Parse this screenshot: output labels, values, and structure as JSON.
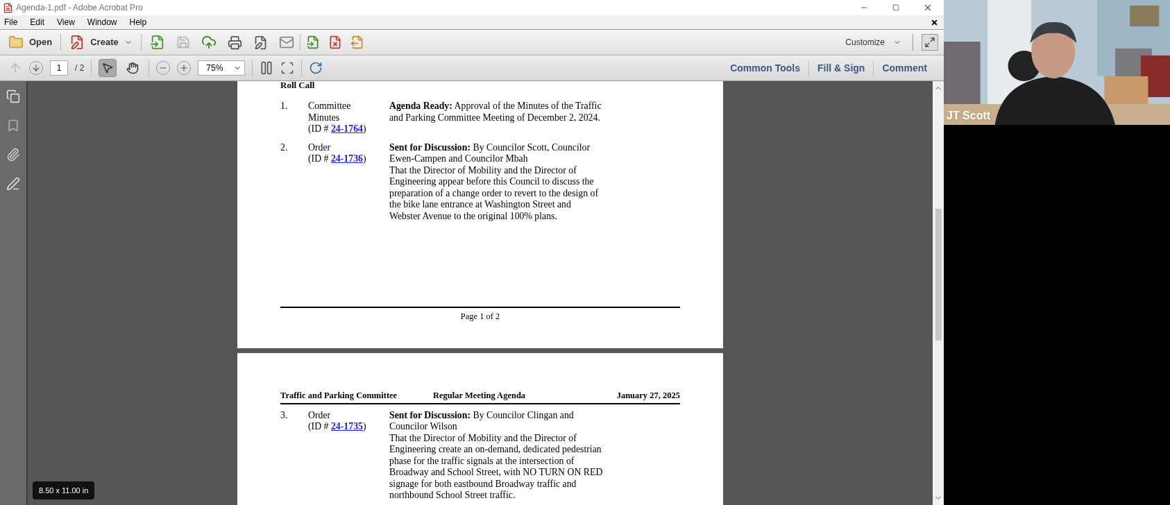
{
  "window": {
    "title": "Agenda-1.pdf - Adobe Acrobat Pro"
  },
  "menu": [
    "File",
    "Edit",
    "View",
    "Window",
    "Help"
  ],
  "toolbar": {
    "open": "Open",
    "create": "Create",
    "customize": "Customize"
  },
  "navigation": {
    "page": "1",
    "total": "/ 2",
    "zoom": "75%"
  },
  "tools": [
    {
      "kind": "select",
      "selected": true
    },
    {
      "kind": "hand",
      "selected": false
    }
  ],
  "tool_links": [
    "Common Tools",
    "Fill & Sign",
    "Comment"
  ],
  "page_1": {
    "heading": "Roll Call",
    "items": [
      {
        "number": "1.",
        "type": "Committee Minutes",
        "id_prefix": "(ID # ",
        "id_link": "24-1764",
        "id_suffix": ")",
        "summary": "**Agenda Ready:** Approval of the Minutes of the Traffic and Parking Committee Meeting of December 2, 2024."
      },
      {
        "number": "2.",
        "type": "Order",
        "id_prefix": "(ID # ",
        "id_link": "24-1736",
        "id_suffix": ")",
        "summary": "**Sent for Discussion:** By Councilor Scott, Councilor Ewen-Campen and Councilor Mbah",
        "body": "That the Director of Mobility and the Director of Engineering appear before this Council to discuss the preparation of a change order to revert to the design of the bike lane entrance at Washington Street and Webster Avenue to the original 100% plans."
      }
    ],
    "footer": "Page 1 of 2"
  },
  "page_2": {
    "header": {
      "left": "Traffic and Parking Committee",
      "center": "Regular Meeting Agenda",
      "right": "January 27, 2025"
    },
    "items": [
      {
        "number": "3.",
        "type": "Order",
        "id_prefix": "(ID # ",
        "id_link": "24-1735",
        "id_suffix": ")",
        "summary": "**Sent for Discussion:** By Councilor Clingan and Councilor Wilson",
        "body": "That the Director of Mobility and the Director of Engineering create an on-demand, dedicated pedestrian phase for the traffic signals at the intersection of Broadway and School Street, with NO TURN ON RED signage for both eastbound Broadway traffic and northbound School Street traffic."
      }
    ]
  },
  "page_size": "8.50 x 11.00 in",
  "video": {
    "kind": "picture",
    "name": "JT Scott"
  }
}
